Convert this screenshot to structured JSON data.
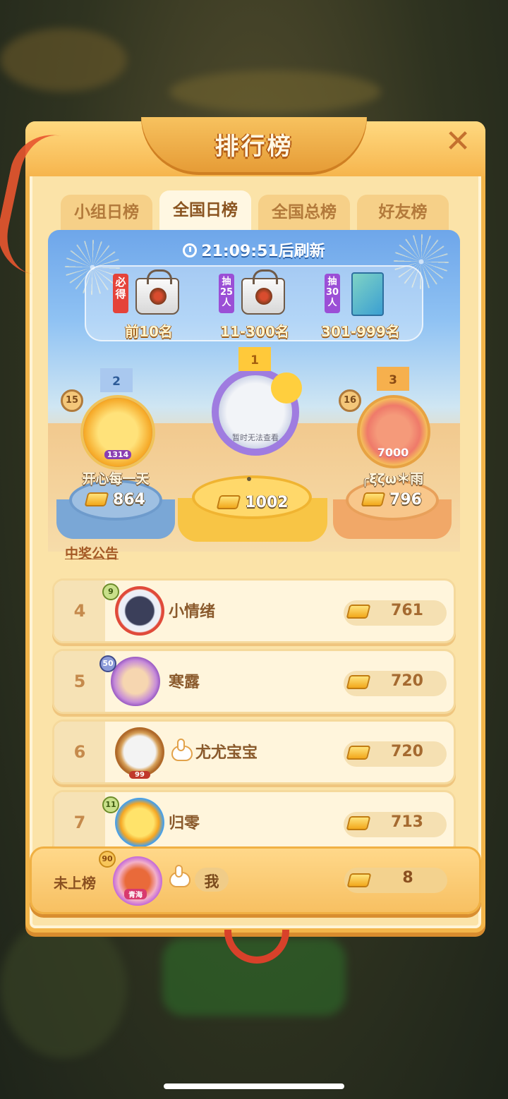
{
  "window": {
    "title": "排行榜"
  },
  "tabs": [
    {
      "label": "小组日榜",
      "active": false
    },
    {
      "label": "全国日榜",
      "active": true
    },
    {
      "label": "全国总榜",
      "active": false
    },
    {
      "label": "好友榜",
      "active": false
    }
  ],
  "countdown": {
    "time": "21:09:51",
    "suffix": "后刷新"
  },
  "rewards": [
    {
      "badge": "必得",
      "range": "前10名",
      "icon": "tote-bag-icon"
    },
    {
      "badge": "抽25人",
      "range": "11-300名",
      "icon": "tote-bag-icon"
    },
    {
      "badge": "抽30人",
      "range": "301-999名",
      "icon": "picture-book-icon"
    }
  ],
  "podium": {
    "first": {
      "rank": "1",
      "name": "",
      "score": "1002",
      "avatar_text": "暂时无法查看"
    },
    "second": {
      "rank": "2",
      "name": "开心每一天",
      "score": "864",
      "level": "15",
      "badge_text": "1314"
    },
    "third": {
      "rank": "3",
      "name": "╭ξζω＊雨",
      "score": "796",
      "level": "16",
      "badge_text": "7000"
    }
  },
  "announcement": "中奖公告",
  "list": [
    {
      "rank": "4",
      "name": "小情绪",
      "score": "761",
      "level": "9"
    },
    {
      "rank": "5",
      "name": "寒露",
      "score": "720",
      "level": "50"
    },
    {
      "rank": "6",
      "name": "尤尤宝宝",
      "score": "720",
      "level": "99"
    },
    {
      "rank": "7",
      "name": "归零",
      "score": "713",
      "level": "11"
    }
  ],
  "me": {
    "rank_label": "未上榜",
    "name": "我",
    "score": "8",
    "level": "90",
    "avatar_tag": "青海"
  },
  "colors": {
    "frame": "#f3b54a",
    "panel_top": "#6ea6ea",
    "gold": "#f8c545",
    "text_brown": "#8a5a2c"
  }
}
